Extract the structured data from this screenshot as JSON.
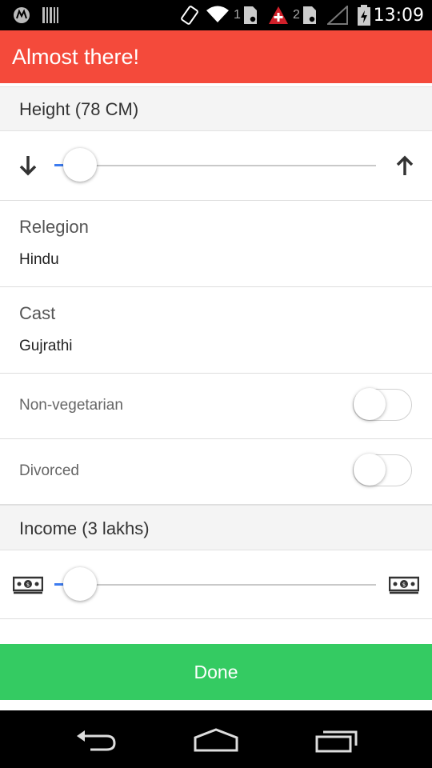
{
  "status_bar": {
    "time": "13:09",
    "sim1": "1",
    "sim2": "2",
    "icons": [
      "motorola-icon",
      "barcode-icon",
      "rotate-icon",
      "wifi-icon",
      "sim-icon",
      "alert-icon",
      "signal-icon",
      "battery-icon"
    ]
  },
  "header": {
    "title": "Almost there!",
    "color": "#f44a3b"
  },
  "height": {
    "title": "Height (78 CM)",
    "slider_fraction": 0.08,
    "decrease_icon": "arrow-down-icon",
    "increase_icon": "arrow-up-icon"
  },
  "religion": {
    "label": "Relegion",
    "value": "Hindu"
  },
  "cast": {
    "label": "Cast",
    "value": "Gujrathi"
  },
  "toggles": [
    {
      "label": "Non-vegetarian",
      "on": false
    },
    {
      "label": "Divorced",
      "on": false
    }
  ],
  "income": {
    "title": "Income (3 lakhs)",
    "slider_fraction": 0.08,
    "min_icon": "money-icon",
    "max_icon": "money-icon"
  },
  "done": {
    "label": "Done",
    "color": "#34cb62"
  },
  "nav": {
    "icons": [
      "back-icon",
      "home-icon",
      "recents-icon"
    ]
  },
  "accent": "#3d7cf0"
}
